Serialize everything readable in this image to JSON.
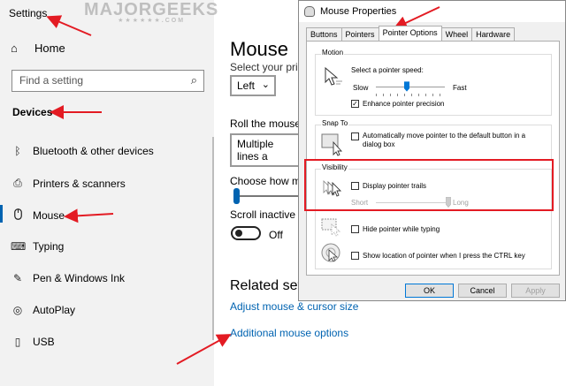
{
  "settings": {
    "window_title": "Settings",
    "home_label": "Home",
    "search_placeholder": "Find a setting",
    "section_label": "Devices",
    "nav_items": [
      {
        "label": "Bluetooth & other devices",
        "icon": "bluetooth-icon"
      },
      {
        "label": "Printers & scanners",
        "icon": "printer-icon"
      },
      {
        "label": "Mouse",
        "icon": "mouse-icon"
      },
      {
        "label": "Typing",
        "icon": "keyboard-icon"
      },
      {
        "label": "Pen & Windows Ink",
        "icon": "pen-icon"
      },
      {
        "label": "AutoPlay",
        "icon": "autoplay-icon"
      },
      {
        "label": "USB",
        "icon": "usb-icon"
      }
    ],
    "active_item": "Mouse"
  },
  "main": {
    "page_title": "Mouse",
    "primary_button_label": "Select your prima",
    "primary_button_value": "Left",
    "scroll_label": "Roll the mouse w",
    "scroll_value": "Multiple lines a",
    "lines_label": "Choose how man",
    "inactive_label": "Scroll inactive wi",
    "inactive_state": "Off",
    "related_heading": "Related setti",
    "links": [
      "Adjust mouse & cursor size",
      "Additional mouse options"
    ]
  },
  "dialog": {
    "title": "Mouse Properties",
    "tabs": [
      "Buttons",
      "Pointers",
      "Pointer Options",
      "Wheel",
      "Hardware"
    ],
    "active_tab": "Pointer Options",
    "motion": {
      "group_label": "Motion",
      "speed_label": "Select a pointer speed:",
      "slow": "Slow",
      "fast": "Fast",
      "speed_level": 0.45,
      "precision_label": "Enhance pointer precision",
      "precision_checked": true
    },
    "snap": {
      "group_label": "Snap To",
      "label_line1": "Automatically move pointer to the default button in a",
      "label_line2": "dialog box",
      "checked": false
    },
    "visibility": {
      "group_label": "Visibility",
      "trails_label": "Display pointer trails",
      "trails_checked": false,
      "short": "Short",
      "long": "Long",
      "trail_level": 1.0,
      "hide_label": "Hide pointer while typing",
      "hide_checked": false,
      "ctrl_label": "Show location of pointer when I press the CTRL key",
      "ctrl_checked": false
    },
    "buttons": {
      "ok": "OK",
      "cancel": "Cancel",
      "apply": "Apply"
    }
  },
  "watermark": {
    "text": "MAJORGEEKS",
    "stars": "★★★★★★.COM"
  },
  "colors": {
    "accent": "#0063b1",
    "annotation": "#e31b23"
  }
}
